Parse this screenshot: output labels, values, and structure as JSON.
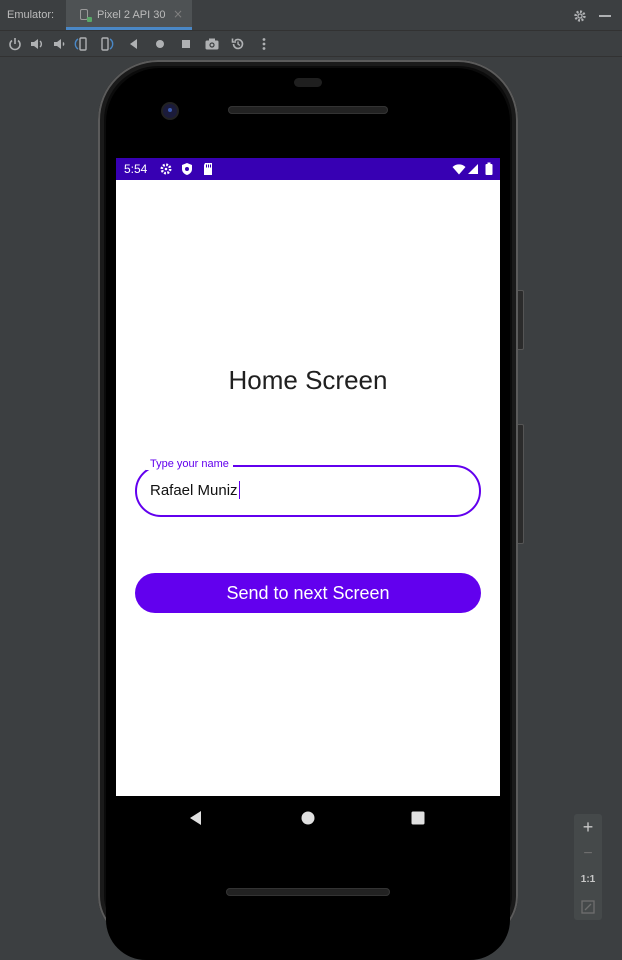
{
  "ide": {
    "tool_window_label": "Emulator:",
    "tab_title": "Pixel 2 API 30",
    "tab_close": "×",
    "toolbar_icons": [
      "power-icon",
      "volume-up-icon",
      "volume-down-icon",
      "rotate-left-icon",
      "rotate-right-icon",
      "back-icon",
      "home-icon",
      "overview-icon",
      "screenshot-icon",
      "snapshot-icon",
      "more-icon"
    ]
  },
  "status_bar": {
    "time": "5:54",
    "left_icons": [
      "settings-icon",
      "shield-icon",
      "sd-card-icon"
    ],
    "right_icons": [
      "wifi-icon",
      "signal-icon",
      "battery-icon"
    ]
  },
  "app": {
    "title": "Home Screen",
    "name_field": {
      "label": "Type your name",
      "value": "Rafael Muniz"
    },
    "send_button": "Send to next Screen",
    "accent_color": "#6200ee",
    "status_bar_color": "#3700b3"
  },
  "zoom_controls": {
    "zoom_in": "+",
    "zoom_out": "−",
    "actual_size": "1:1"
  }
}
